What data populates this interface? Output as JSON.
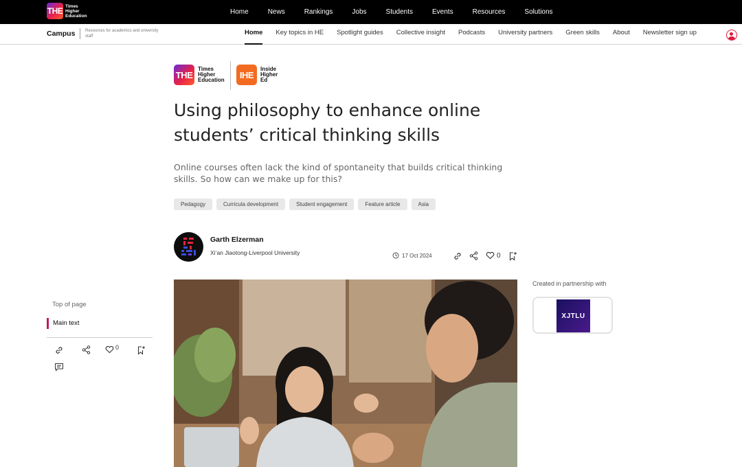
{
  "topbar": {
    "logo_badge": "THE",
    "logo_lines": [
      "Times",
      "Higher",
      "Education"
    ],
    "nav": [
      "Home",
      "News",
      "Rankings",
      "Jobs",
      "Students",
      "Events",
      "Resources",
      "Solutions"
    ]
  },
  "campusbar": {
    "title": "Campus",
    "subtitle": "Resources for academics and university staff",
    "nav": [
      "Home",
      "Key topics in HE",
      "Spotlight guides",
      "Collective insight",
      "Podcasts",
      "University partners",
      "Green skills",
      "About",
      "Newsletter sign up"
    ],
    "active_index": 0
  },
  "partners": {
    "the_badge": "THE",
    "the_lines": [
      "Times",
      "Higher",
      "Education"
    ],
    "ihe_badge": "IHE",
    "ihe_lines": [
      "Inside",
      "Higher",
      "Ed"
    ]
  },
  "article": {
    "title": "Using philosophy to enhance online students’ critical thinking skills",
    "standfirst": "Online courses often lack the kind of spontaneity that builds critical thinking skills. So how can we make up for this?",
    "tags": [
      "Pedagogy",
      "Curricula development",
      "Student engagement",
      "Feature article",
      "Asia"
    ],
    "author_name": "Garth Elzerman",
    "author_institution": "Xi’an Jiaotong-Liverpool University",
    "date": "17 Oct 2024",
    "likes": "0"
  },
  "sidebar_right": {
    "partner_label": "Created in partnership with",
    "partner_logo": "XJTLU"
  },
  "sidebar_left": {
    "toc_top": "Top of page",
    "toc_main": "Main text",
    "likes": "0"
  },
  "colors": {
    "accent": "#c2185b",
    "topbar": "#000000",
    "user_icon": "#e0163c"
  }
}
